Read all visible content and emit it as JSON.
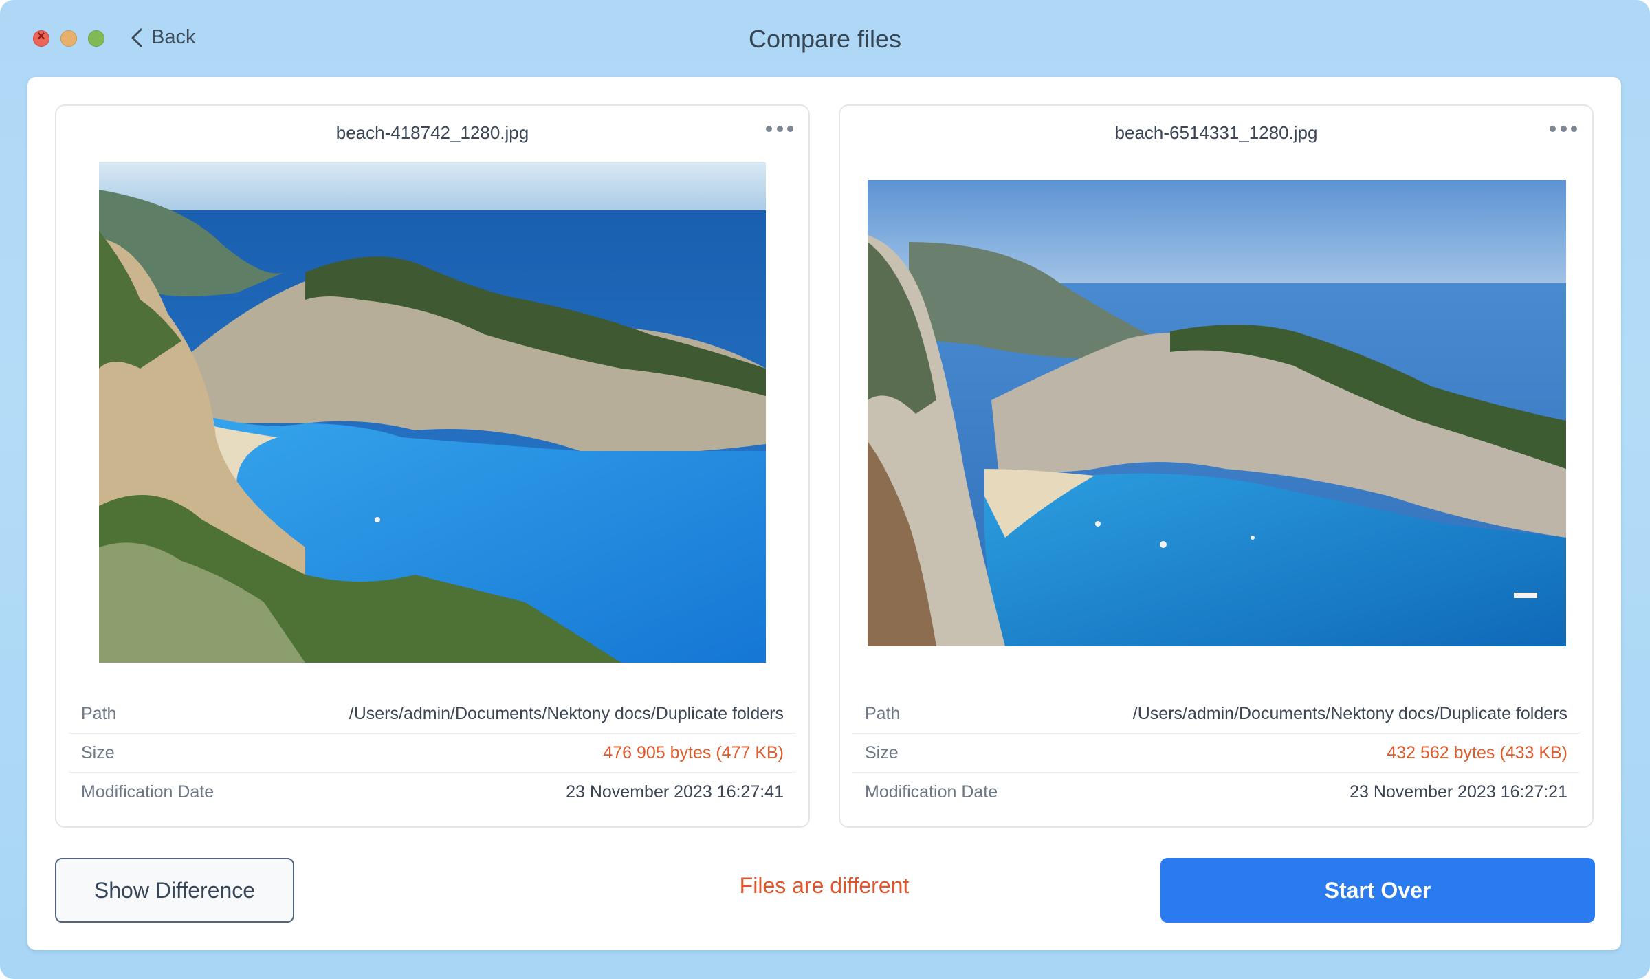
{
  "window": {
    "title": "Compare files",
    "back_label": "Back"
  },
  "files": [
    {
      "name": "beach-418742_1280.jpg",
      "path_label": "Path",
      "path": "/Users/admin/Documents/Nektony docs/Duplicate folders",
      "size_label": "Size",
      "size": "476 905 bytes (477 KB)",
      "date_label": "Modification Date",
      "date": "23 November 2023 16:27:41"
    },
    {
      "name": "beach-6514331_1280.jpg",
      "path_label": "Path",
      "path": "/Users/admin/Documents/Nektony docs/Duplicate folders",
      "size_label": "Size",
      "size": "432 562 bytes (433 KB)",
      "date_label": "Modification Date",
      "date": "23 November 2023 16:27:21"
    }
  ],
  "footer": {
    "show_difference_label": "Show Difference",
    "status": "Files are different",
    "start_over_label": "Start Over"
  },
  "colors": {
    "accent": "#2b7bf0",
    "difference": "#e05a2c"
  }
}
